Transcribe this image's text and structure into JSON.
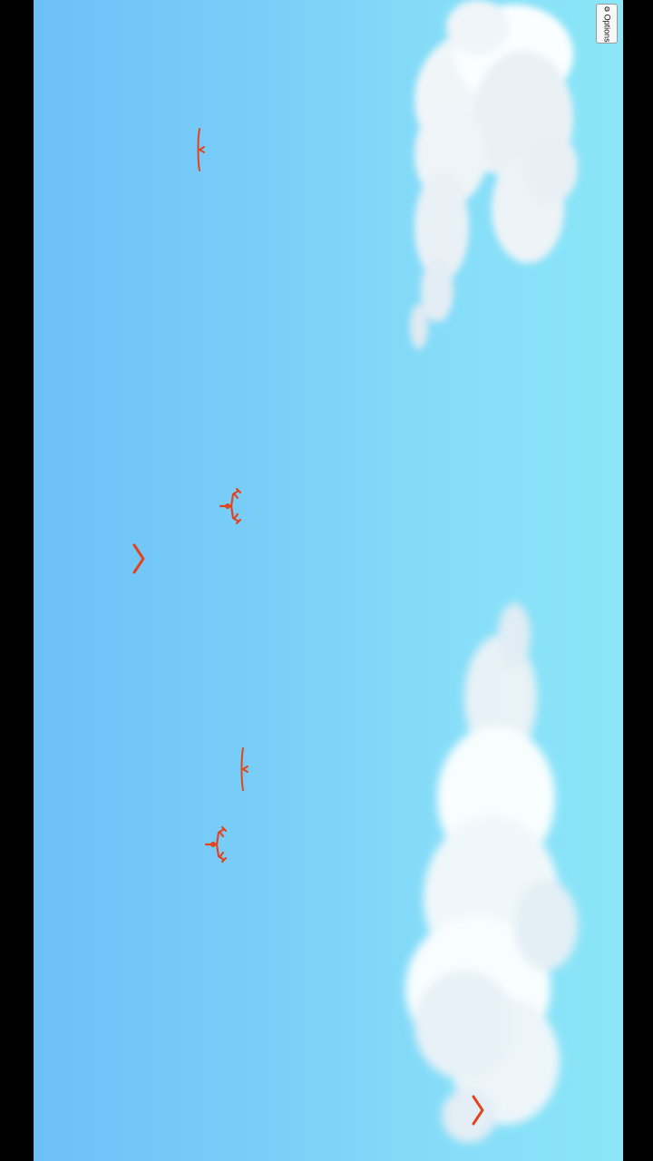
{
  "options_button": {
    "label": "Options",
    "icon": "gear-icon"
  },
  "colors": {
    "sky_dark": "#6cc0f7",
    "sky_light": "#8be6f8",
    "sprite": "#e0451f",
    "letterbox": "#000000"
  }
}
